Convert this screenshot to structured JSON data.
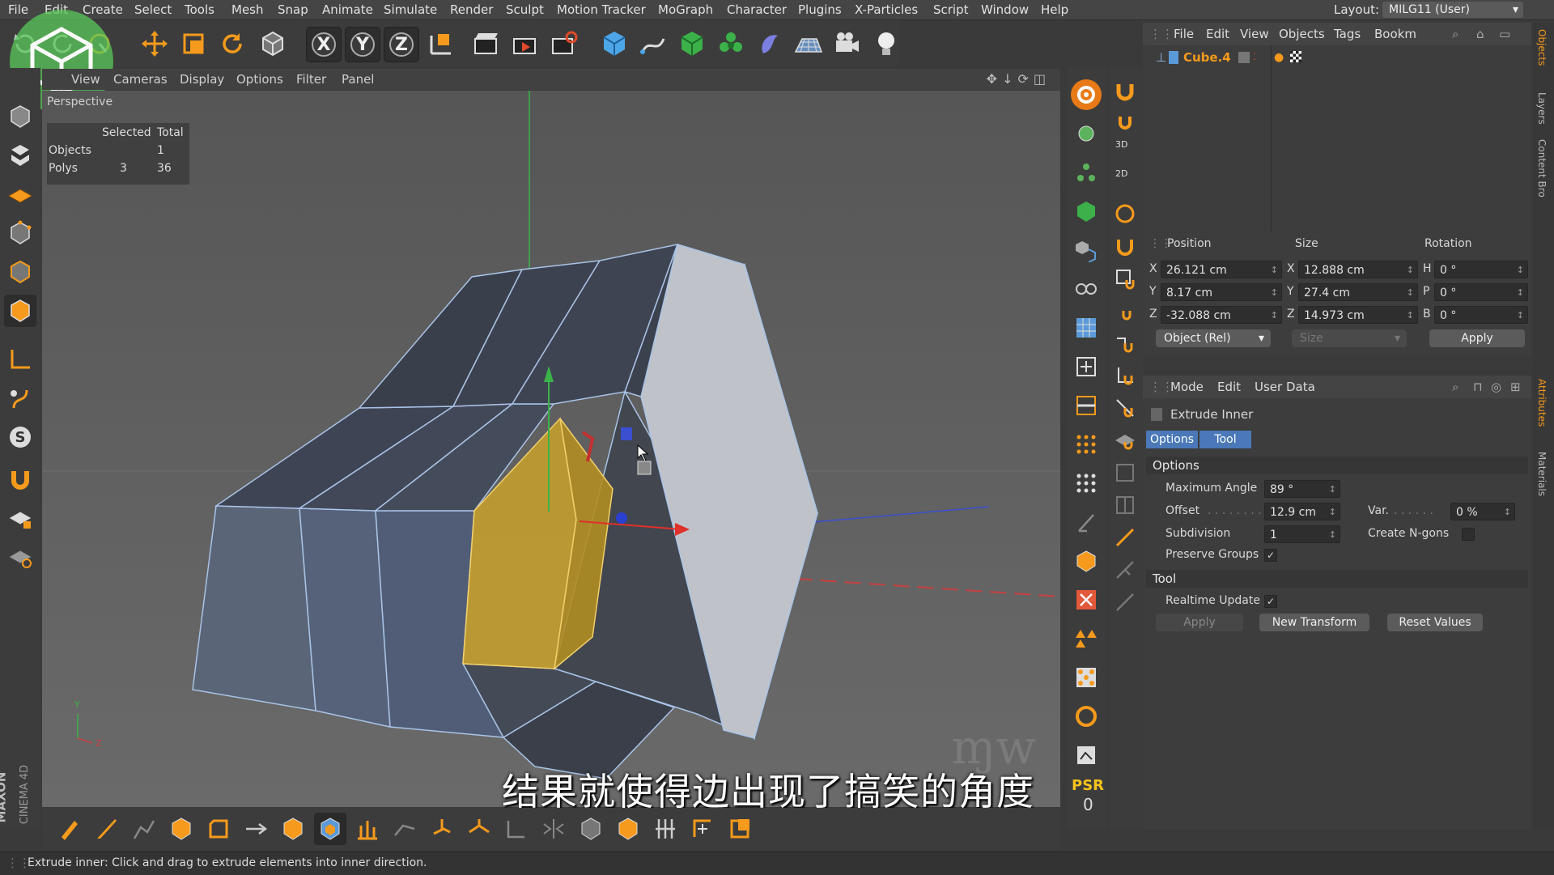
{
  "menubar": {
    "items": [
      "File",
      "Edit",
      "Create",
      "Select",
      "Tools",
      "Mesh",
      "Snap",
      "Animate",
      "Simulate",
      "Render",
      "Sculpt",
      "Motion Tracker",
      "MoGraph",
      "Character",
      "Plugins",
      "X-Particles",
      "Script",
      "Window",
      "Help"
    ],
    "layout_label": "Layout:",
    "layout_value": "MILG11 (User)"
  },
  "toolbar": {
    "axis_x": "X",
    "axis_y": "Y",
    "axis_z": "Z"
  },
  "viewport": {
    "menu": [
      "View",
      "Cameras",
      "Display",
      "Options",
      "Filter",
      "Panel"
    ],
    "camera_label": "Perspective",
    "hud": {
      "col_selected": "Selected",
      "col_total": "Total",
      "rows": [
        {
          "label": "Objects",
          "selected": "",
          "total": "1"
        },
        {
          "label": "Polys",
          "selected": "3",
          "total": "36"
        }
      ]
    },
    "axis_y": "Y",
    "axis_z": "Z",
    "subtitle": "结果就使得边出现了搞笑的角度"
  },
  "brand": {
    "maxon": "MAXON",
    "cinema": "CINEMA 4D"
  },
  "right_strip": {
    "label_3d": "3D",
    "label_2d": "2D",
    "psr": "PSR",
    "psr_value": "0"
  },
  "object_manager": {
    "menu": [
      "File",
      "Edit",
      "View",
      "Objects",
      "Tags",
      "Bookm"
    ],
    "object_name": "Cube.4"
  },
  "coordinates": {
    "headers": {
      "position": "Position",
      "size": "Size",
      "rotation": "Rotation"
    },
    "rows": [
      {
        "axis": "X",
        "pos": "26.121 cm",
        "size_axis": "X",
        "size": "12.888 cm",
        "rot_axis": "H",
        "rot": "0 °"
      },
      {
        "axis": "Y",
        "pos": "8.17 cm",
        "size_axis": "Y",
        "size": "27.4 cm",
        "rot_axis": "P",
        "rot": "0 °"
      },
      {
        "axis": "Z",
        "pos": "-32.088 cm",
        "size_axis": "Z",
        "size": "14.973 cm",
        "rot_axis": "B",
        "rot": "0 °"
      }
    ],
    "mode_select": "Object (Rel)",
    "size_select": "Size",
    "apply": "Apply"
  },
  "attributes": {
    "menu": [
      "Mode",
      "Edit",
      "User Data"
    ],
    "tool_name": "Extrude Inner",
    "tabs": [
      "Options",
      "Tool"
    ],
    "options_header": "Options",
    "max_angle_label": "Maximum Angle",
    "max_angle": "89 °",
    "offset_label": "Offset",
    "offset": "12.9 cm",
    "var_label": "Var.",
    "var": "0 %",
    "subdivision_label": "Subdivision",
    "subdivision": "1",
    "create_ngons_label": "Create N-gons",
    "preserve_groups_label": "Preserve Groups",
    "tool_header": "Tool",
    "realtime_label": "Realtime Update",
    "apply": "Apply",
    "new_transform": "New Transform",
    "reset_values": "Reset Values"
  },
  "side_tabs": [
    "Objects",
    "Layers",
    "Content Bro",
    "Attributes",
    "Materials"
  ],
  "status": "Extrude inner: Click and drag to extrude elements into inner direction.",
  "colors": {
    "accent_orange": "#f59a1c",
    "selection_gold": "#c9a12a",
    "bg_dark": "#3c3c3c"
  }
}
